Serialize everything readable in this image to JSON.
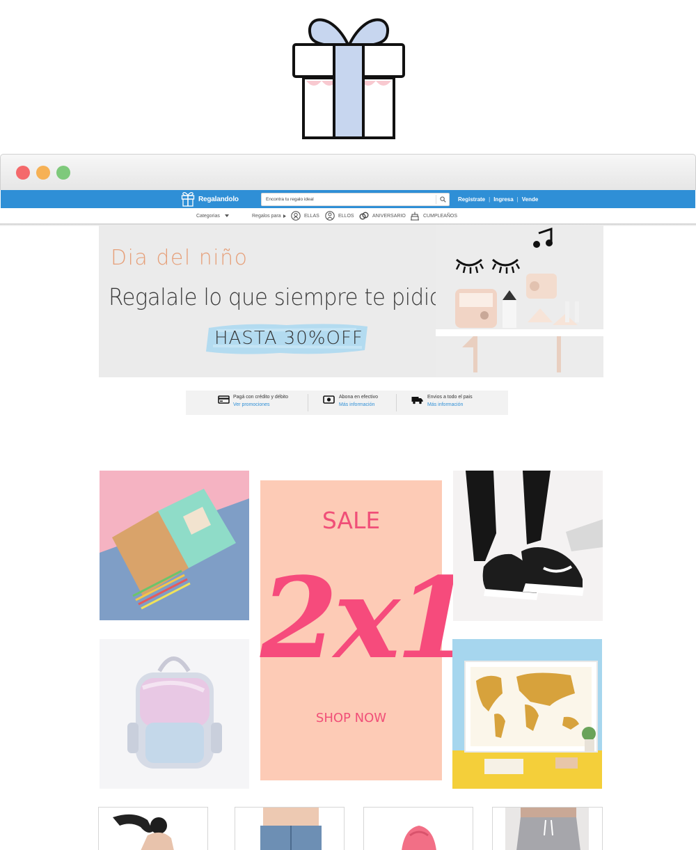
{
  "site": {
    "brand_name": "Regalandolo",
    "search_placeholder": "Encontra tu regalo ideal",
    "header_links": [
      "Registrate",
      "Ingresa",
      "Vende"
    ],
    "categories_label": "Categorias",
    "gifts_for_label": "Regalos para",
    "gift_for_items": [
      {
        "label": "ELLAS",
        "icon": "woman-icon"
      },
      {
        "label": "ELLOS",
        "icon": "man-icon"
      },
      {
        "label": "ANIVERSARIO",
        "icon": "rings-icon"
      },
      {
        "label": "CUMPLEAÑOS",
        "icon": "cake-icon"
      }
    ]
  },
  "banner": {
    "kicker": "Dia del niño",
    "headline": "Regalale lo que siempre te pidio",
    "promo": "HASTA 30%OFF"
  },
  "info_strip": [
    {
      "title": "Pagá con crédito y débito",
      "link": "Ver promociones",
      "icon": "credit-card-icon"
    },
    {
      "title": "Abona en efectivo",
      "link": "Más información",
      "icon": "cash-icon"
    },
    {
      "title": "Envios a todo el pais",
      "link": "Más información",
      "icon": "truck-icon"
    }
  ],
  "promo_card": {
    "sale": "SALE",
    "deal": "2x1",
    "cta": "SHOP NOW"
  },
  "colors": {
    "header_blue": "#2f8fd6",
    "promo_pink": "#f64b7c",
    "promo_bg": "#fdcbb6",
    "kicker_orange": "#e6a07a"
  }
}
